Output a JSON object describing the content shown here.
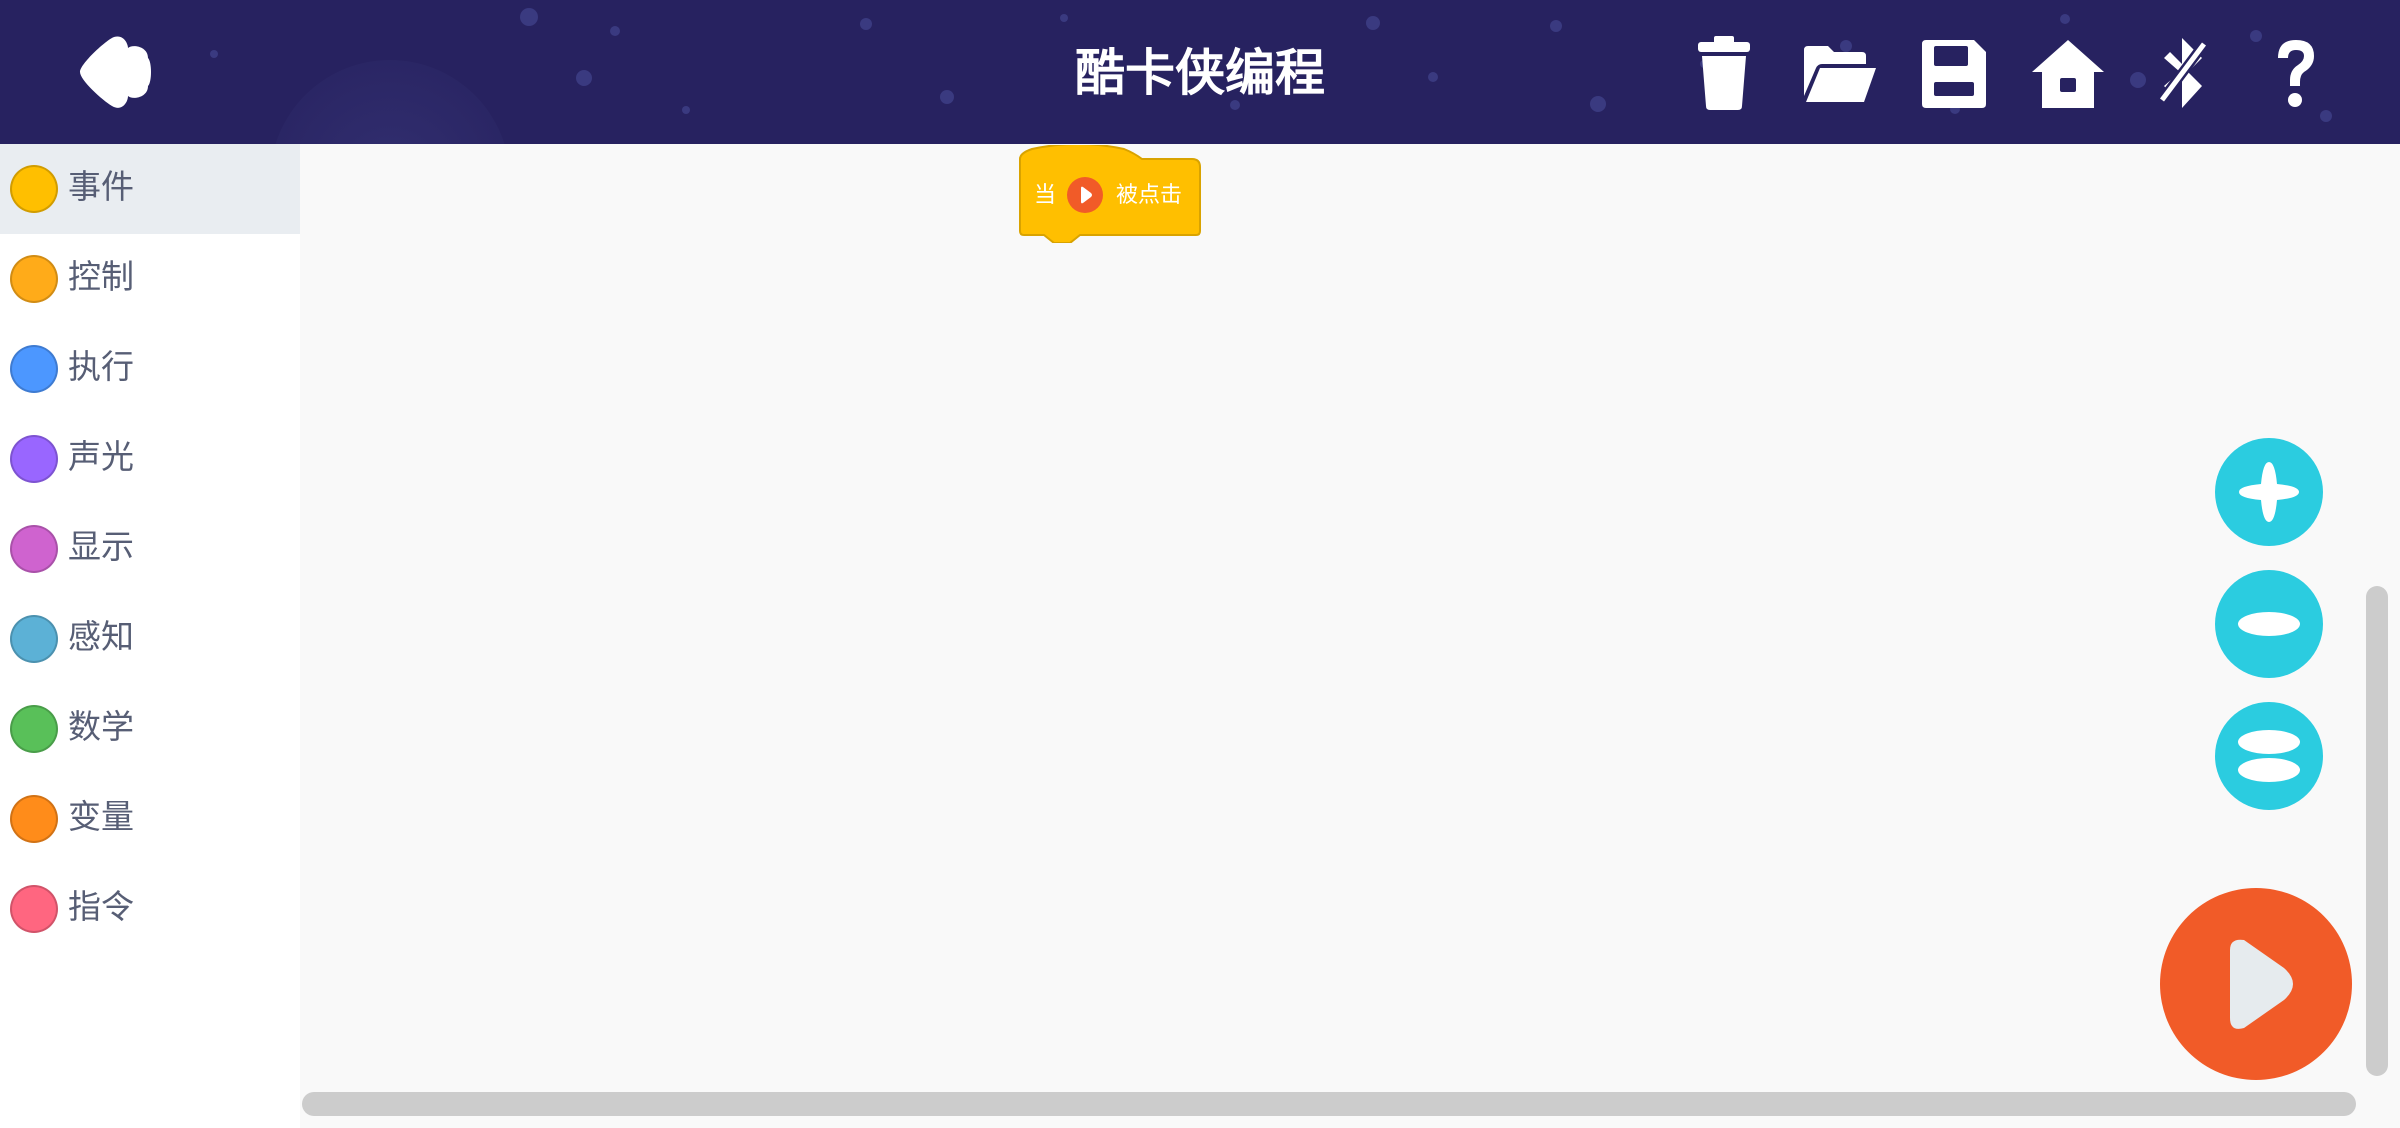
{
  "header": {
    "title": "酷卡侠编程",
    "background_color": "#272260",
    "icons": {
      "back": "back-arrow-icon",
      "trash": "trash-icon",
      "open": "folder-open-icon",
      "save": "floppy-save-icon",
      "home": "home-icon",
      "bluetooth": "bluetooth-disabled-icon",
      "help": "question-mark-icon"
    }
  },
  "sidebar": {
    "categories": [
      {
        "label": "事件",
        "color": "#ffbf00",
        "selected": true
      },
      {
        "label": "控制",
        "color": "#ffab19",
        "selected": false
      },
      {
        "label": "执行",
        "color": "#4c97ff",
        "selected": false
      },
      {
        "label": "声光",
        "color": "#9966ff",
        "selected": false
      },
      {
        "label": "显示",
        "color": "#cf63cf",
        "selected": false
      },
      {
        "label": "感知",
        "color": "#5cb1d6",
        "selected": false
      },
      {
        "label": "数学",
        "color": "#59c059",
        "selected": false
      },
      {
        "label": "变量",
        "color": "#ff8c1a",
        "selected": false
      },
      {
        "label": "指令",
        "color": "#ff6680",
        "selected": false
      }
    ]
  },
  "workspace": {
    "event_block": {
      "prefix": "当",
      "suffix": "被点击",
      "color": "#ffbf00",
      "icon": "run-flag-icon"
    },
    "zoom_controls": {
      "zoom_in_icon": "zoom-in-icon",
      "zoom_out_icon": "zoom-out-icon",
      "zoom_reset_icon": "zoom-reset-icon",
      "color": "#2bcce0"
    },
    "run_button": {
      "icon": "play-icon",
      "color": "#f15b28"
    }
  }
}
